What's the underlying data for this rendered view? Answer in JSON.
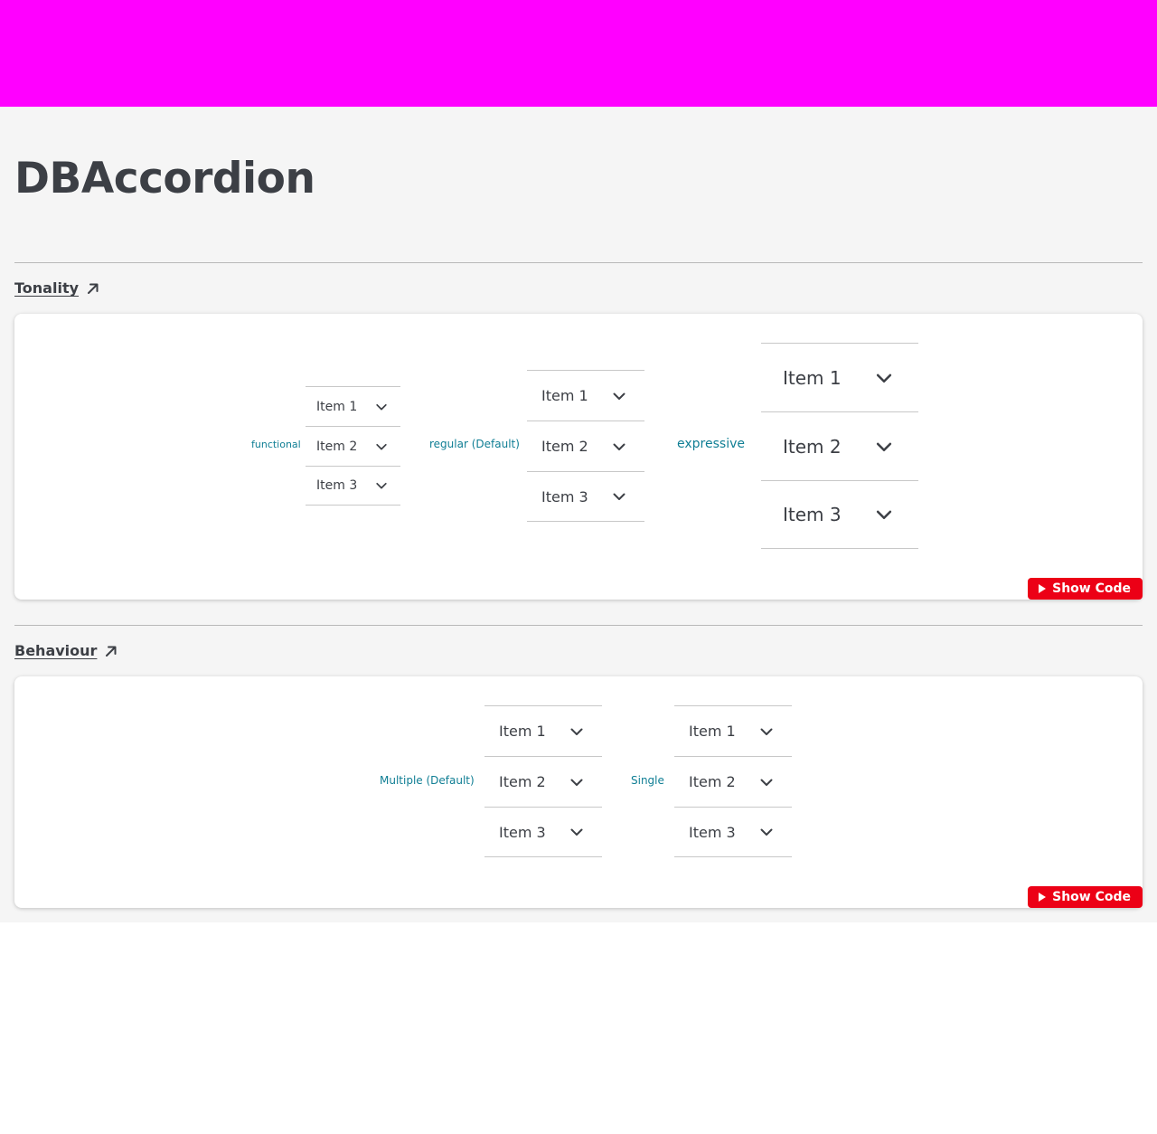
{
  "page": {
    "title": "DBAccordion",
    "top_bar_color": "#ff00ff",
    "accent_color": "#ec0016",
    "label_color": "#0f7e94"
  },
  "sections": [
    {
      "title": "Tonality",
      "link_icon": "arrow-up-right-icon",
      "show_code_label": "Show Code",
      "variants": [
        {
          "label": "functional",
          "items": [
            "Item 1",
            "Item 2",
            "Item 3"
          ]
        },
        {
          "label": "regular (Default)",
          "items": [
            "Item 1",
            "Item 2",
            "Item 3"
          ]
        },
        {
          "label": "expressive",
          "items": [
            "Item 1",
            "Item 2",
            "Item 3"
          ]
        }
      ]
    },
    {
      "title": "Behaviour",
      "link_icon": "arrow-up-right-icon",
      "show_code_label": "Show Code",
      "variants": [
        {
          "label": "Multiple (Default)",
          "items": [
            "Item 1",
            "Item 2",
            "Item 3"
          ]
        },
        {
          "label": "Single",
          "items": [
            "Item 1",
            "Item 2",
            "Item 3"
          ]
        }
      ]
    }
  ]
}
